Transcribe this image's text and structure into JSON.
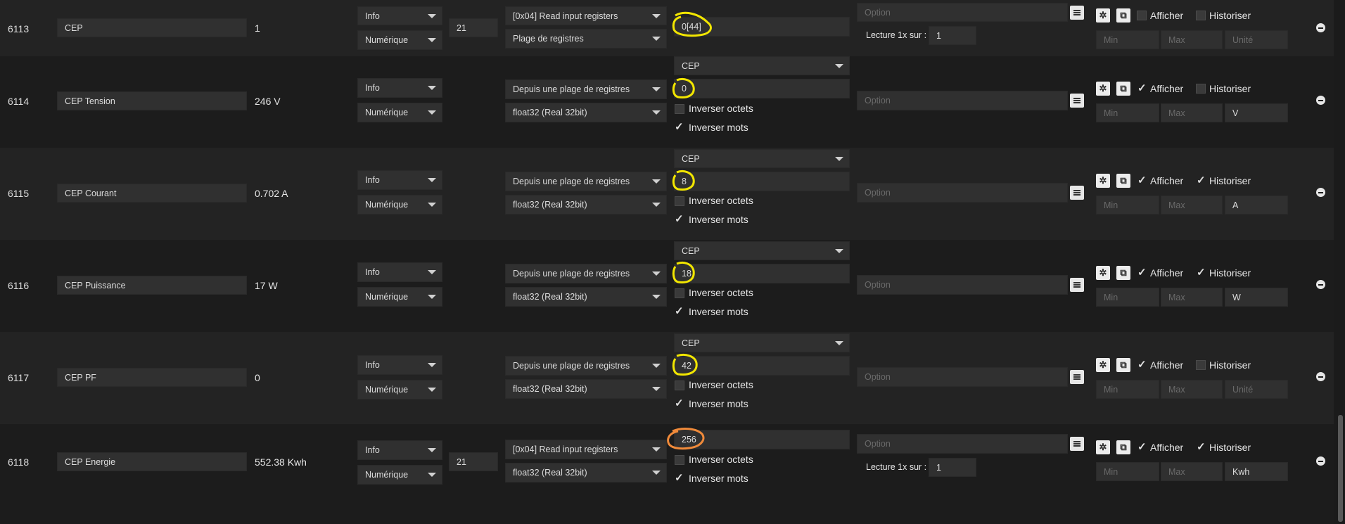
{
  "option_placeholder": "Option",
  "min_placeholder": "Min",
  "max_placeholder": "Max",
  "labels": {
    "afficher": "Afficher",
    "historiser": "Historiser",
    "inverser_octets": "Inverser octets",
    "inverser_mots": "Inverser mots",
    "lecture": "Lecture 1x sur :"
  },
  "colors": {
    "highlight_yellow": "#f2e600",
    "highlight_orange": "#f08a3a"
  },
  "rows": [
    {
      "id": "6113",
      "name": "CEP",
      "value": "1",
      "type": "Info",
      "subtype": "Numérique",
      "slave": "21",
      "function": "[0x04] Read input registers",
      "format": "Plage de registres",
      "address": "0[44]",
      "afficher": false,
      "historiser": false,
      "lecture": "1",
      "unit": "",
      "unit_placeholder": "Unité"
    },
    {
      "id": "6114",
      "name": "CEP Tension",
      "value": "246 V",
      "type": "Info",
      "subtype": "Numérique",
      "function": "Depuis une plage de registres",
      "format": "float32 (Real 32bit)",
      "source": "CEP",
      "address": "0",
      "inv_octets": false,
      "inv_mots": true,
      "afficher": true,
      "historiser": false,
      "unit": "V"
    },
    {
      "id": "6115",
      "name": "CEP Courant",
      "value": "0.702 A",
      "type": "Info",
      "subtype": "Numérique",
      "function": "Depuis une plage de registres",
      "format": "float32 (Real 32bit)",
      "source": "CEP",
      "address": "8",
      "inv_octets": false,
      "inv_mots": true,
      "afficher": true,
      "historiser": true,
      "unit": "A"
    },
    {
      "id": "6116",
      "name": "CEP Puissance",
      "value": "17 W",
      "type": "Info",
      "subtype": "Numérique",
      "function": "Depuis une plage de registres",
      "format": "float32 (Real 32bit)",
      "source": "CEP",
      "address": "18",
      "inv_octets": false,
      "inv_mots": true,
      "afficher": true,
      "historiser": true,
      "unit": "W"
    },
    {
      "id": "6117",
      "name": "CEP PF",
      "value": "0",
      "type": "Info",
      "subtype": "Numérique",
      "function": "Depuis une plage de registres",
      "format": "float32 (Real 32bit)",
      "source": "CEP",
      "address": "42",
      "inv_octets": false,
      "inv_mots": true,
      "afficher": true,
      "historiser": false,
      "unit": "",
      "unit_placeholder": "Unité"
    },
    {
      "id": "6118",
      "name": "CEP Energie",
      "value": "552.38 Kwh",
      "type": "Info",
      "subtype": "Numérique",
      "slave": "21",
      "function": "[0x04] Read input registers",
      "format": "float32 (Real 32bit)",
      "address": "256",
      "inv_octets": false,
      "inv_mots": true,
      "afficher": true,
      "historiser": true,
      "lecture": "1",
      "unit": "Kwh"
    }
  ]
}
